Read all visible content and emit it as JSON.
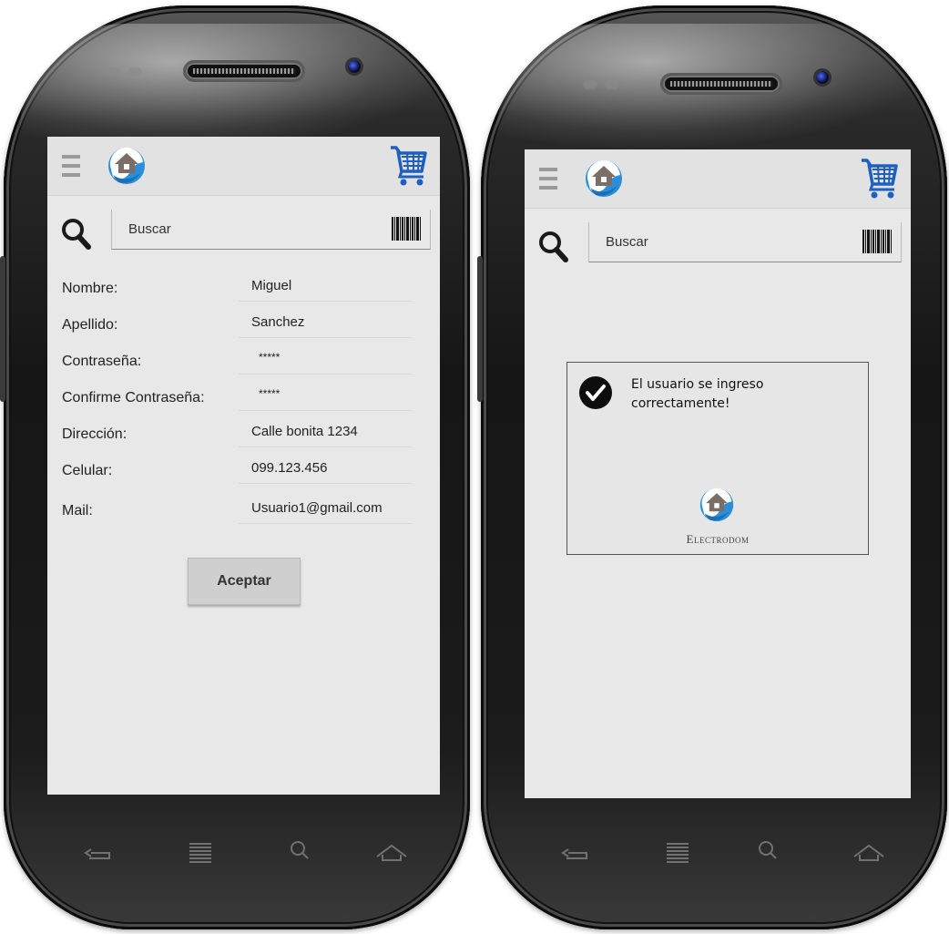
{
  "left_screen": {
    "search": {
      "placeholder": "Buscar"
    },
    "form": {
      "rows": [
        {
          "label": "Nombre:",
          "value": "Miguel"
        },
        {
          "label": "Apellido:",
          "value": "Sanchez"
        },
        {
          "label": "Contraseña:",
          "value": "*****"
        },
        {
          "label": "Confirme Contraseña:",
          "value": "*****"
        },
        {
          "label": "Dirección:",
          "value": "Calle bonita 1234"
        },
        {
          "label": "Celular:",
          "value": "099.123.456"
        },
        {
          "label": "Mail:",
          "value": "Usuario1@gmail.com"
        }
      ],
      "accept_label": "Aceptar"
    }
  },
  "right_screen": {
    "search": {
      "placeholder": "Buscar"
    },
    "dialog": {
      "message": "El usuario se ingreso correctamente!",
      "brand": "Electrodom"
    }
  },
  "colors": {
    "cart_blue": "#1f5fbf",
    "logo_blue": "#2a8fd8",
    "logo_gray": "#7a6e66"
  },
  "icons": [
    "menu-icon",
    "logo-icon",
    "cart-icon",
    "search-icon",
    "barcode-icon",
    "check-icon",
    "back-icon",
    "recent-icon",
    "home-icon"
  ]
}
